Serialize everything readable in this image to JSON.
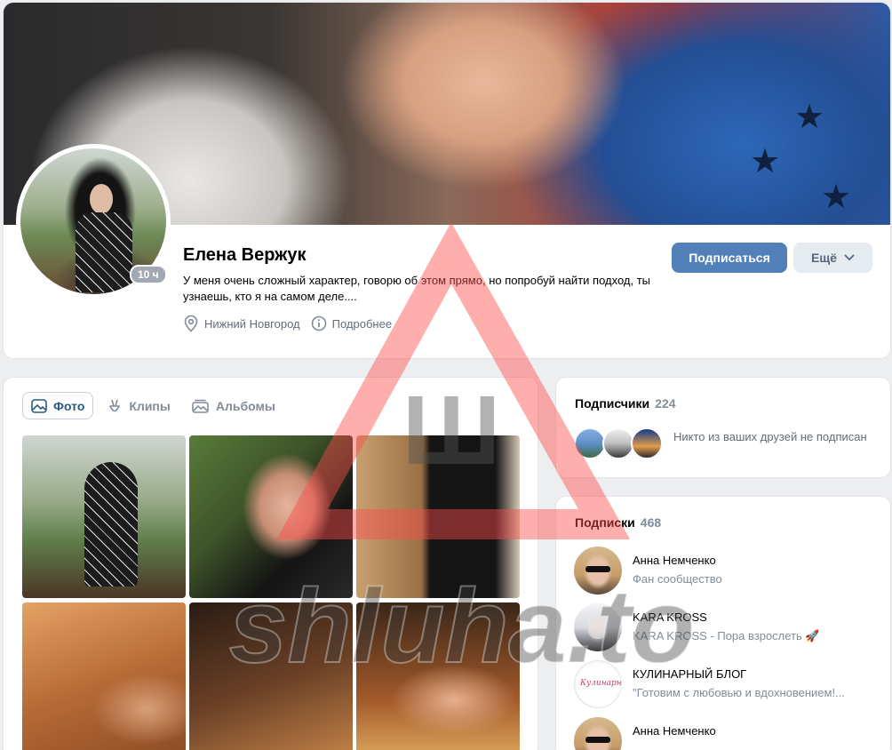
{
  "profile": {
    "name": "Елена Вержук",
    "status_badge": "10 ч",
    "bio": "У меня очень сложный характер, говорю об этом прямо, но попробуй найти подход, ты узнаешь, кто я на самом деле....",
    "city": "Нижний Новгород",
    "details_link": "Подробнее",
    "subscribe_label": "Подписаться",
    "more_label": "Ещё"
  },
  "tabs": [
    {
      "label": "Фото",
      "icon": "photo-icon",
      "active": true
    },
    {
      "label": "Клипы",
      "icon": "clips-icon",
      "active": false
    },
    {
      "label": "Альбомы",
      "icon": "albums-icon",
      "active": false
    }
  ],
  "followers": {
    "title": "Подписчики",
    "count": "224",
    "note": "Никто из ваших друзей не подписан"
  },
  "subscriptions": {
    "title": "Подписки",
    "count": "468",
    "items": [
      {
        "name": "Анна Немченко",
        "desc": "Фан сообщество"
      },
      {
        "name": "KARA KROSS",
        "desc": "KARA KROSS - Пора взрослеть 🚀"
      },
      {
        "name": "КУЛИНАРНЫЙ БЛОГ",
        "desc": "\"Готовим с любовью и вдохновением!..."
      },
      {
        "name": "Анна Немченко",
        "desc": ""
      }
    ]
  },
  "watermark": {
    "text": "shluha.to",
    "triangle_letter": "Ш"
  },
  "colors": {
    "accent": "#5181b8",
    "link": "#2a5885",
    "secondary_text": "#818c99",
    "watermark_red": "#ff4b4b"
  }
}
